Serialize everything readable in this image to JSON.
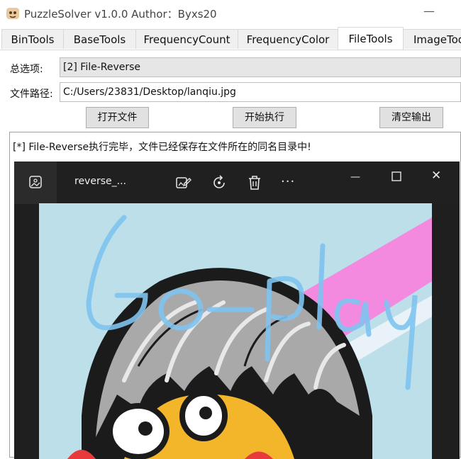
{
  "app": {
    "title": "PuzzleSolver v1.0.0  Author：Byxs20",
    "minimize_glyph": "—"
  },
  "tabs": [
    {
      "label": "BinTools",
      "active": false
    },
    {
      "label": "BaseTools",
      "active": false
    },
    {
      "label": "FrequencyCount",
      "active": false
    },
    {
      "label": "FrequencyColor",
      "active": false
    },
    {
      "label": "FileTools",
      "active": true
    },
    {
      "label": "ImageTools",
      "active": false
    }
  ],
  "form": {
    "option_label": "总选项:",
    "option_value": "[2] File-Reverse",
    "path_label": "文件路径:",
    "path_value": "C:/Users/23831/Desktop/lanqiu.jpg"
  },
  "buttons": {
    "open_file": "打开文件",
    "start": "开始执行",
    "clear_output": "清空输出"
  },
  "output": {
    "text": "[*] File-Reverse执行完毕，文件已经保存在文件所在的同名目录中!"
  },
  "viewer": {
    "filename": "reverse_...",
    "more_glyph": "···",
    "minimize_glyph": "—",
    "close_glyph": "✕",
    "handwriting": "Go-play"
  },
  "colors": {
    "viewer_bg": "#202020",
    "image_bg": "#bcdfe9",
    "handwriting": "#7ec3f0",
    "stripe": "#f48adf"
  }
}
